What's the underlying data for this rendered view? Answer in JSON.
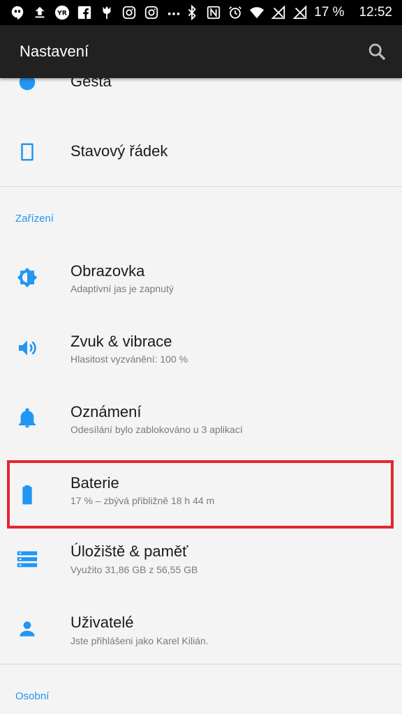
{
  "status_bar": {
    "left_icons": [
      "hangouts-icon",
      "upload-icon",
      "yr-weather-icon",
      "facebook-icon",
      "tulip-icon",
      "instagram-icon",
      "instagram-icon",
      "more-icon"
    ],
    "right_icons": [
      "bluetooth-icon",
      "nfc-icon",
      "alarm-icon",
      "wifi-icon",
      "no-signal-icon",
      "no-signal-icon"
    ],
    "battery": "17 %",
    "time": "12:52"
  },
  "appbar": {
    "title": "Nastavení",
    "search_icon": "search-icon"
  },
  "items_top": [
    {
      "title": "Gesta",
      "icon": "gesture-dot-icon"
    },
    {
      "title": "Stavový řádek",
      "icon": "status-bar-phone-icon"
    }
  ],
  "section_device": "Zařízení",
  "items_device": [
    {
      "title": "Obrazovka",
      "subtitle": "Adaptivní jas je zapnutý",
      "icon": "brightness-icon"
    },
    {
      "title": "Zvuk & vibrace",
      "subtitle": "Hlasitost vyzvánění: 100 %",
      "icon": "volume-icon"
    },
    {
      "title": "Oznámení",
      "subtitle": "Odesílání bylo zablokováno u 3 aplikací",
      "icon": "bell-icon"
    },
    {
      "title": "Baterie",
      "subtitle": "17 % – zbývá přibližně 18 h 44 m",
      "icon": "battery-icon"
    },
    {
      "title": "Úložiště & paměť",
      "subtitle": "Využito 31,86 GB z 56,55 GB",
      "icon": "storage-icon"
    },
    {
      "title": "Uživatelé",
      "subtitle": "Jste přihlášeni jako Karel Kilián.",
      "icon": "person-icon"
    }
  ],
  "section_personal": "Osobní",
  "colors": {
    "accent": "#2196f3",
    "highlight": "#e5262f",
    "appbar": "#212121"
  }
}
